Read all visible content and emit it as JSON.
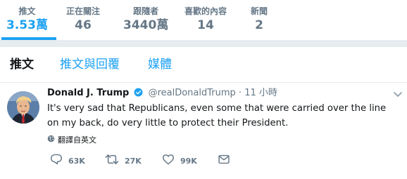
{
  "stats": [
    {
      "label": "推文",
      "value": "3.53萬",
      "active": true
    },
    {
      "label": "正在關注",
      "value": "46"
    },
    {
      "label": "跟隨者",
      "value": "3440萬"
    },
    {
      "label": "喜歡的內容",
      "value": "14"
    },
    {
      "label": "新聞",
      "value": "2"
    }
  ],
  "tabs": [
    "推文",
    "推文與回覆",
    "媒體"
  ],
  "tweet": {
    "name": "Donald J. Trump",
    "handle": "@realDonaldTrump",
    "separator": "·",
    "time": "11 小時",
    "text": "It's very sad that Republicans, even some that were carried over the line on my back, do very little to protect their President.",
    "translate_label": "翻譯自英文",
    "replies": "63K",
    "retweets": "27K",
    "likes": "99K"
  },
  "colors": {
    "accent": "#1da1f2",
    "muted": "#657786",
    "background": "#e6ecf0"
  },
  "icons": [
    "verified-badge-icon",
    "chevron-down-icon",
    "globe-icon",
    "reply-icon",
    "retweet-icon",
    "like-icon",
    "direct-message-icon"
  ]
}
